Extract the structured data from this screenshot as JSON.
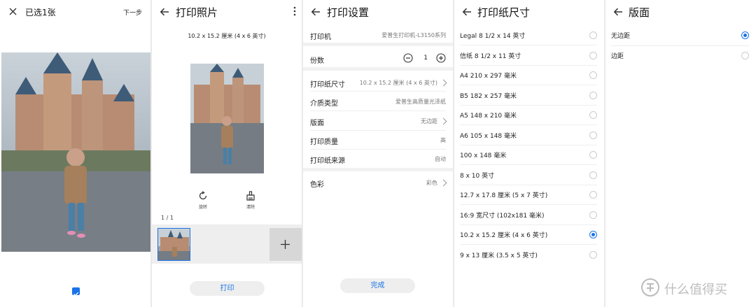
{
  "panel1": {
    "title": "已选1张",
    "next": "下一步"
  },
  "panel2": {
    "title": "打印照片",
    "paper_size": "10.2 x 15.2 厘米 (4 x 6 英寸)",
    "rotate": "旋转",
    "clear": "清除",
    "pager": "1 / 1",
    "print": "打印"
  },
  "panel3": {
    "title": "打印设置",
    "printer_k": "打印机",
    "printer_v": "爱普生打印机-L3150系列",
    "copies_k": "份数",
    "copies_v": "1",
    "size_k": "打印纸尺寸",
    "size_v": "10.2 x 15.2 厘米 (4 x 6 英寸)",
    "media_k": "介质类型",
    "media_v": "爱普生高质量光泽纸",
    "layout_k": "版面",
    "layout_v": "无边距",
    "quality_k": "打印质量",
    "quality_v": "高",
    "source_k": "打印纸来源",
    "source_v": "自动",
    "color_k": "色彩",
    "color_v": "彩色",
    "done": "完成"
  },
  "panel4": {
    "title": "打印纸尺寸",
    "items": [
      "Legal 8 1/2 x 14 英寸",
      "信纸 8 1/2 x 11 英寸",
      "A4 210 x 297 毫米",
      "B5 182 x 257 毫米",
      "A5 148 x 210 毫米",
      "A6 105 x 148 毫米",
      "100 x 148 毫米",
      "8 x 10 英寸",
      "12.7 x 17.8 厘米 (5 x 7 英寸)",
      "16:9 宽尺寸 (102x181 毫米)",
      "10.2 x 15.2 厘米 (4 x 6 英寸)",
      "9 x 13 厘米 (3.5 x 5 英寸)"
    ],
    "selected_index": 10
  },
  "panel5": {
    "title": "版面",
    "opt1": "无边距",
    "opt2": "边距",
    "watermark": "什么值得买"
  },
  "colors": {
    "accent": "#1a73e8"
  }
}
